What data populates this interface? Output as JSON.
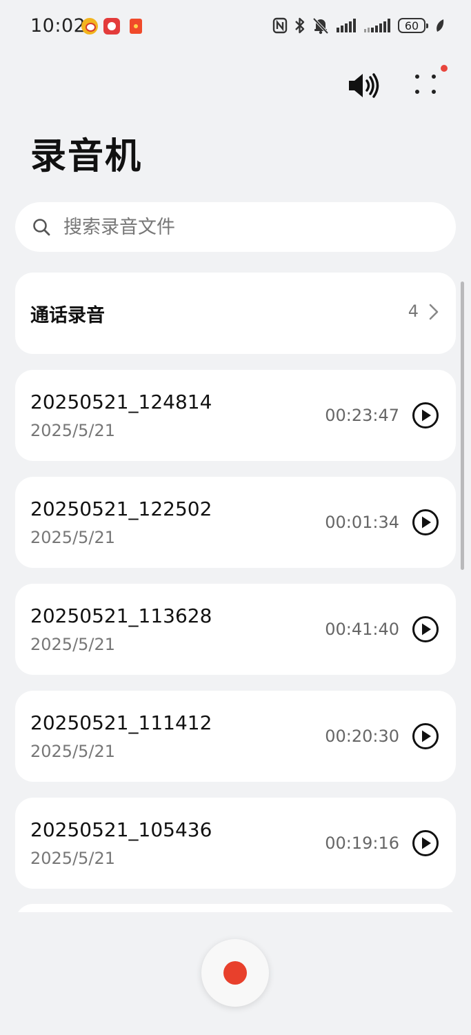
{
  "status_bar": {
    "time": "10:02",
    "battery": "60"
  },
  "header": {
    "title": "录音机"
  },
  "search": {
    "placeholder": "搜索录音文件"
  },
  "call_recordings": {
    "label": "通话录音",
    "count": "4"
  },
  "recordings": [
    {
      "name": "20250521_124814",
      "date": "2025/5/21",
      "duration": "00:23:47"
    },
    {
      "name": "20250521_122502",
      "date": "2025/5/21",
      "duration": "00:01:34"
    },
    {
      "name": "20250521_113628",
      "date": "2025/5/21",
      "duration": "00:41:40"
    },
    {
      "name": "20250521_111412",
      "date": "2025/5/21",
      "duration": "00:20:30"
    },
    {
      "name": "20250521_105436",
      "date": "2025/5/21",
      "duration": "00:19:16"
    }
  ],
  "colors": {
    "record_accent": "#e8402c",
    "background": "#f1f2f4",
    "notification_dot": "#e8453c"
  },
  "icons": {
    "speaker": "speaker-volume-icon",
    "more": "more-dots-icon",
    "search": "search-icon",
    "chevron": "chevron-right-icon",
    "play": "play-circle-icon",
    "record": "record-icon"
  }
}
